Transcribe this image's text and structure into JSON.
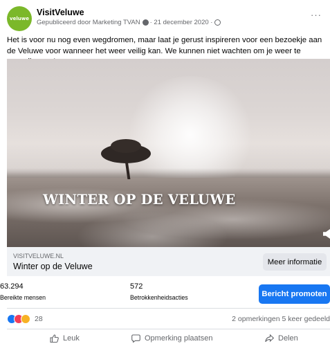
{
  "post": {
    "page_name": "VisitVeluwe",
    "avatar_text": "veluwe",
    "published_by": "Gepubliceerd door Marketing TVAN",
    "date": "· 21 december 2020 ·",
    "more": "···",
    "text": "Het is voor nu nog even wegdromen, maar laat je gerust inspireren voor een bezoekje aan de Veluwe voor wanneer het weer veilig kan. We kunnen niet wachten om je weer te verwelkomen!"
  },
  "media": {
    "overlay_title": "WINTER OP DE VELUWE"
  },
  "link": {
    "domain": "VISITVELUWE.NL",
    "title": "Winter op de Veluwe",
    "button": "Meer informatie"
  },
  "insights": {
    "reach_value": "63.294",
    "reach_label": "Bereikte mensen",
    "engagement_value": "572",
    "engagement_label": "Betrokkenheidsacties",
    "promote_button": "Bericht promoten"
  },
  "reactions": {
    "count": "28",
    "summary": "2 opmerkingen  5 keer gedeeld",
    "icons": [
      "like-icon",
      "love-icon",
      "care-icon"
    ]
  },
  "actions": {
    "like": "Leuk",
    "comment": "Opmerking plaatsen",
    "share": "Delen"
  },
  "colors": {
    "brand": "#7bb82a",
    "primary": "#1877f2",
    "secondary_text": "#65676b",
    "link_box_bg": "#f0f2f5"
  }
}
